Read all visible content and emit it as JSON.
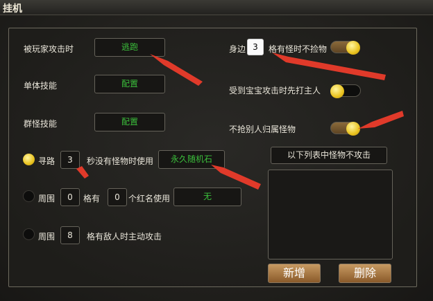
{
  "window": {
    "title": "挂机"
  },
  "left": {
    "attacked_label": "被玩家攻击时",
    "attacked_value": "逃跑",
    "single_skill_label": "单体技能",
    "single_skill_value": "配置",
    "group_skill_label": "群怪技能",
    "group_skill_value": "配置"
  },
  "pathing": {
    "label": "寻路",
    "seconds": "3",
    "text": "秒没有怪物时使用",
    "item": "永久随机石"
  },
  "around_red": {
    "label": "周围",
    "count_a": "0",
    "text_a": "格有",
    "count_b": "0",
    "text_b": "个红名使用",
    "item": "无"
  },
  "around_enemy": {
    "label": "周围",
    "count": "8",
    "text": "格有敌人时主动攻击"
  },
  "right": {
    "side_label": "身边",
    "side_value": "3",
    "no_loot_label": "格有怪时不捡物",
    "pet_attack_label": "受到宝宝攻击时先打主人",
    "no_steal_label": "不抢别人归属怪物"
  },
  "monster_list": {
    "header": "以下列表中怪物不攻击",
    "add_button": "新增",
    "delete_button": "删除"
  },
  "colors": {
    "accent_red": "#e03a2a",
    "value_green": "#3bbf3b",
    "knob_yellow": "#e9c21e"
  }
}
